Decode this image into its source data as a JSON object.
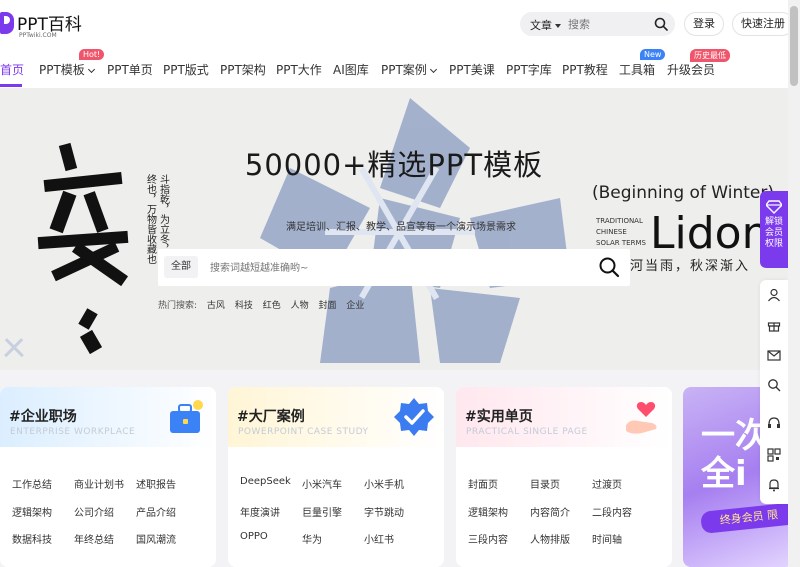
{
  "brand": {
    "name": "PPT百科",
    "domain": "PPTwiki.COM"
  },
  "header": {
    "search_category": "文章",
    "search_placeholder": "搜索",
    "login_label": "登录",
    "register_label": "快速注册"
  },
  "nav": {
    "items": [
      {
        "label": "首页"
      },
      {
        "label": "PPT模板"
      },
      {
        "label": "PPT单页"
      },
      {
        "label": "PPT版式"
      },
      {
        "label": "PPT架构"
      },
      {
        "label": "PPT大作"
      },
      {
        "label": "AI图库"
      },
      {
        "label": "PPT案例"
      },
      {
        "label": "PPT美课"
      },
      {
        "label": "PPT字库"
      },
      {
        "label": "PPT教程"
      },
      {
        "label": "工具箱"
      },
      {
        "label": "升级会员"
      }
    ],
    "badges": {
      "hot": "Hot!",
      "new": "New",
      "vip": "历史最低"
    },
    "badge_colors": {
      "hot": "#f0566b",
      "new": "#3b82f6",
      "vip": "#f0566b"
    }
  },
  "hero": {
    "title": "50000+精选PPT模板",
    "subtitle": "满足培训、汇报、教学、品宣等每一个演示场景需求",
    "search_category": "全部",
    "search_placeholder": "搜索词越短越准确哟~",
    "hot_label": "热门搜索:",
    "hot_tags": [
      "古风",
      "科技",
      "红色",
      "人物",
      "封面",
      "企业"
    ],
    "art": {
      "calligraphy": "立冬",
      "poem_col1": "斗指乾，为立冬，冬",
      "poem_col2": "终也，万物皆收藏也",
      "en_line": "(Beginning of Winter)",
      "lidong": "Lidon",
      "tag1": "TRADITIONAL",
      "tag2": "CHINESE",
      "tag3": "SOLAR TERMS",
      "cn_line": "河当雨，秋深渐入"
    }
  },
  "cards": [
    {
      "title": "#企业职场",
      "en": "ENTERPRISE WORKPLACE",
      "icon": "briefcase-icon",
      "gradient": [
        "#dbeeff",
        "#ffffff"
      ],
      "links": [
        "工作总结",
        "商业计划书",
        "述职报告",
        "逻辑架构",
        "公司介绍",
        "产品介绍",
        "数据科技",
        "年终总结",
        "国风潮流"
      ]
    },
    {
      "title": "#大厂案例",
      "en": "POWERPOINT CASE STUDY",
      "icon": "verified-badge-icon",
      "gradient": [
        "#fff5d6",
        "#ffffff"
      ],
      "links": [
        "DeepSeek",
        "小米汽车",
        "小米手机",
        "年度演讲",
        "巨量引擎",
        "字节跳动",
        "OPPO",
        "华为",
        "小红书"
      ]
    },
    {
      "title": "#实用单页",
      "en": "PRACTICAL SINGLE PAGE",
      "icon": "heart-hand-icon",
      "gradient": [
        "#ffe7ee",
        "#ffffff"
      ],
      "links": [
        "封面页",
        "目录页",
        "过渡页",
        "逻辑架构",
        "内容简介",
        "二段内容",
        "三段内容",
        "人物排版",
        "时间轴"
      ]
    }
  ],
  "promo": {
    "big_text": "一次\n全i",
    "band": "终身会员 限"
  },
  "side": {
    "vip_lines": [
      "解锁",
      "会员",
      "权限"
    ],
    "tools": [
      "user-icon",
      "gift-icon",
      "mail-icon",
      "search-icon",
      "headset-icon",
      "qrcode-icon",
      "bell-icon"
    ]
  }
}
